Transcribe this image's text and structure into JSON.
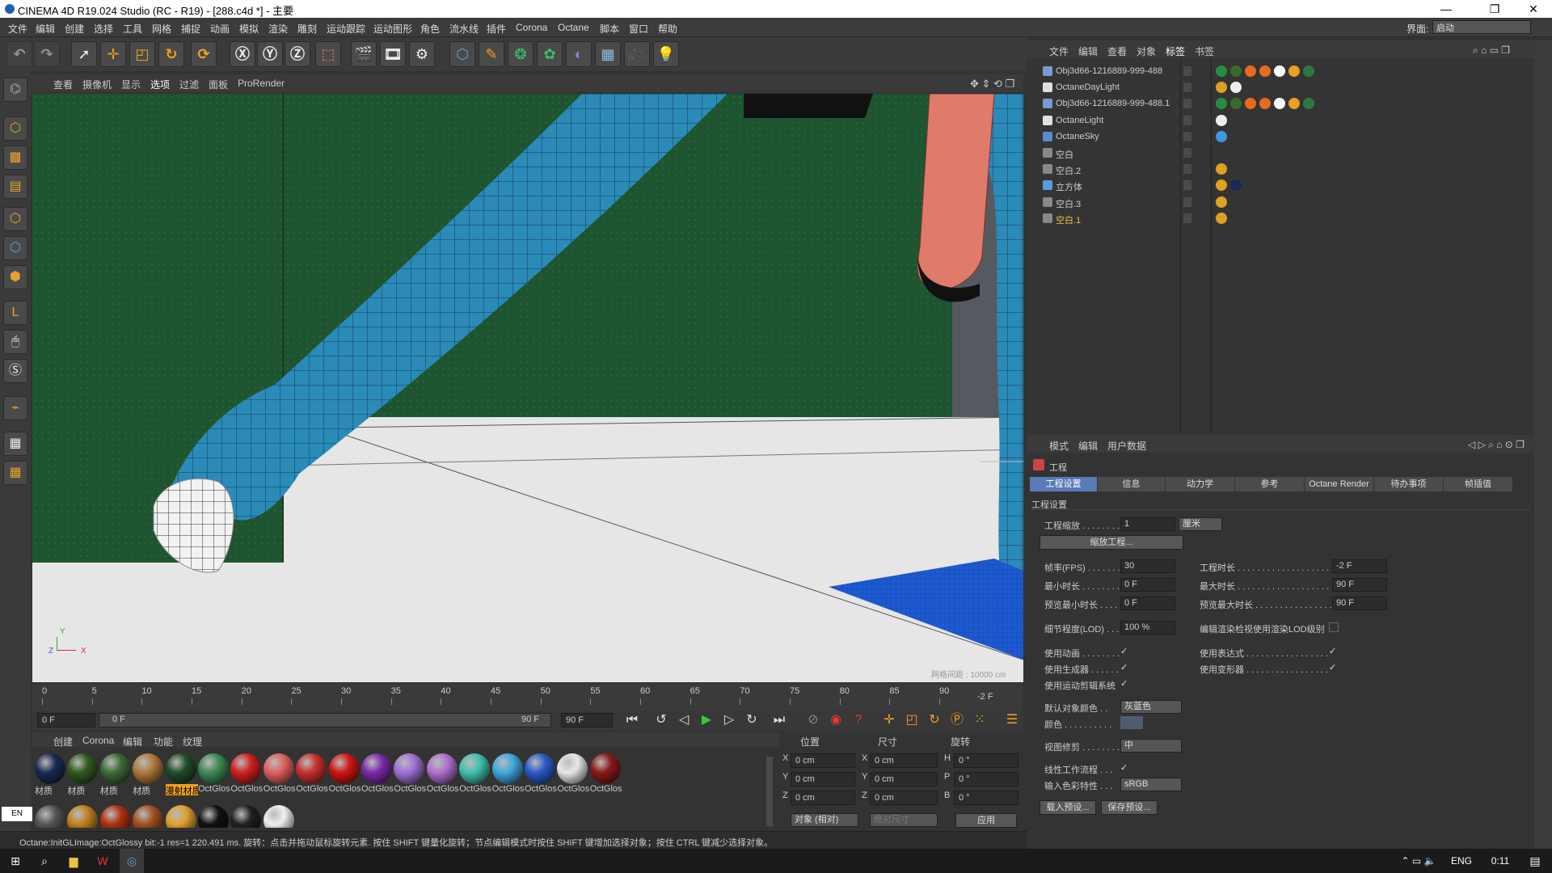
{
  "window": {
    "title": "CINEMA 4D R19.024 Studio (RC - R19) - [288.c4d *] - 主要",
    "min": "—",
    "max": "❐",
    "close": "✕"
  },
  "menu": [
    "文件",
    "编辑",
    "创建",
    "选择",
    "工具",
    "网格",
    "捕捉",
    "动画",
    "模拟",
    "渲染",
    "雕刻",
    "运动跟踪",
    "运动图形",
    "角色",
    "流水线",
    "插件",
    "Corona",
    "Octane",
    "脚本",
    "窗口",
    "帮助"
  ],
  "layout": {
    "label": "界面:",
    "value": "启动"
  },
  "viewport_menu": [
    "查看",
    "摄像机",
    "显示",
    "选项",
    "过滤",
    "面板",
    "ProRender"
  ],
  "viewport": {
    "grid_label": "网格间距 : 10000 cm",
    "axis_y": "Y",
    "axis_z": "Z",
    "axis_x": "X"
  },
  "timeline": {
    "ticks": [
      "0",
      "5",
      "10",
      "15",
      "20",
      "25",
      "30",
      "35",
      "40",
      "45",
      "50",
      "55",
      "60",
      "65",
      "70",
      "75",
      "80",
      "85",
      "90"
    ],
    "frame_display": "-2 F"
  },
  "transport": {
    "start": "0 F",
    "range_start": "0 F",
    "range_end": "90 F",
    "end": "90 F"
  },
  "materials": {
    "tabs": [
      "创建",
      "Corona",
      "编辑",
      "功能",
      "纹理"
    ],
    "row1": [
      {
        "label": "材质",
        "color": "#1a2a55"
      },
      {
        "label": "材质",
        "color": "#2f5a1e"
      },
      {
        "label": "材质",
        "color": "#3d6a38"
      },
      {
        "label": "材质",
        "color": "#b07a3a"
      },
      {
        "label": "漫射材质",
        "color": "#1f4d2a"
      },
      {
        "label": "OctGlos",
        "color": "#3d8a55"
      },
      {
        "label": "OctGlos",
        "color": "#d02020"
      },
      {
        "label": "OctGlos",
        "color": "#e06060"
      },
      {
        "label": "OctGlos",
        "color": "#c83030"
      },
      {
        "label": "OctGlos",
        "color": "#d01515"
      },
      {
        "label": "OctGlos",
        "color": "#7a2aa8"
      },
      {
        "label": "OctGlos",
        "color": "#a070d8"
      },
      {
        "label": "OctGlos",
        "color": "#b070d0"
      },
      {
        "label": "OctGlos",
        "color": "#40c0b0"
      },
      {
        "label": "OctGlos",
        "color": "#40a8e0"
      },
      {
        "label": "OctGlos",
        "color": "#2a5ac8"
      },
      {
        "label": "OctGlos",
        "color": "#e8e8e8"
      },
      {
        "label": "OctGlos",
        "color": "#8a1a1a"
      }
    ],
    "row2": [
      "#555",
      "#c08020",
      "#b03010",
      "#a05020",
      "#e0a030",
      "#111",
      "#202020",
      "#f0f0f0"
    ],
    "lang": "EN"
  },
  "coords": {
    "headers": [
      "位置",
      "尺寸",
      "旋转"
    ],
    "rows": [
      {
        "axis": "X",
        "pos": "0 cm",
        "size_axis": "X",
        "size": "0 cm",
        "rot_axis": "H",
        "rot": "0 °"
      },
      {
        "axis": "Y",
        "pos": "0 cm",
        "size_axis": "Y",
        "size": "0 cm",
        "rot_axis": "P",
        "rot": "0 °"
      },
      {
        "axis": "Z",
        "pos": "0 cm",
        "size_axis": "Z",
        "size": "0 cm",
        "rot_axis": "B",
        "rot": "0 °"
      }
    ],
    "mode": "对象 (相对)",
    "size_mode": "绝对尺寸",
    "apply": "应用"
  },
  "status": "Octane:InitGLImage:OctGlossy  bit:-1 res=1  220.491 ms.     旋转：点击并拖动鼠标旋转元素. 按住 SHIFT 键量化旋转；节点编辑模式时按住 SHIFT 键增加选择对象；按住 CTRL 键减少选择对象。",
  "objects": {
    "menu": [
      "文件",
      "编辑",
      "查看",
      "对象",
      "标签",
      "书签"
    ],
    "items": [
      {
        "name": "Obj3d66-1216889-999-488",
        "color": "#ccc",
        "icon": "#7a9ad0"
      },
      {
        "name": "OctaneDayLight",
        "color": "#ccc",
        "icon": "#e0e0e0"
      },
      {
        "name": "Obj3d66-1216889-999-488.1",
        "color": "#ccc",
        "icon": "#7a9ad0"
      },
      {
        "name": "OctaneLight",
        "color": "#ccc",
        "icon": "#e0e0e0"
      },
      {
        "name": "OctaneSky",
        "color": "#ccc",
        "icon": "#5a8ad0"
      },
      {
        "name": "空白",
        "color": "#ccc",
        "icon": "#888"
      },
      {
        "name": "空白.2",
        "color": "#ccc",
        "icon": "#888"
      },
      {
        "name": "立方体",
        "color": "#ccc",
        "icon": "#5a9ae0"
      },
      {
        "name": "空白.3",
        "color": "#ccc",
        "icon": "#888"
      },
      {
        "name": "空白.1",
        "color": "#f0c040",
        "icon": "#888"
      }
    ]
  },
  "attributes": {
    "menu": [
      "模式",
      "编辑",
      "用户数据"
    ],
    "section": "工程",
    "tabs": [
      "工程设置",
      "信息",
      "动力学",
      "参考",
      "Octane Render",
      "待办事项",
      "帧插值"
    ],
    "group": "工程设置",
    "scale_label": "工程缩放 . . . . . . . .",
    "scale_value": "1",
    "scale_unit": "厘米",
    "scale_button": "缩放工程...",
    "fps_label": "帧率(FPS) . . . . . . .",
    "fps": "30",
    "proj_time_label": "工程时长 . . . . . . . . . . . . . . . . . . .",
    "proj_time": "-2 F",
    "min_time_label": "最小时长 . . . . . . . .",
    "min_time": "0 F",
    "max_time_label": "最大时长 . . . . . . . . . . . . . . . . . . .",
    "max_time": "90 F",
    "prev_min_label": "预览最小时长 . . . .",
    "prev_min": "0 F",
    "prev_max_label": "预览最大时长 . . . . . . . . . . . . . . . .",
    "prev_max": "90 F",
    "lod_label": "细节程度(LOD) . . .",
    "lod": "100 %",
    "lod_render_label": "编辑渲染检视使用渲染LOD级别",
    "use_anim": "使用动画 . . . . . . . .",
    "use_expr": "使用表达式 . . . . . . . . . . . . . . . . .",
    "use_gen": "使用生成器 . . . . . .",
    "use_deform": "使用变形器 . . . . . . . . . . . . . . . . .",
    "use_motion": "使用运动剪辑系统",
    "default_color_label": "默认对象颜色 . .",
    "default_color": "灰蓝色",
    "color_label": "颜色 . . . . . . . . . .",
    "clip_label": "视图修剪 . . . . . . . .",
    "clip": "中",
    "linear_label": "线性工作流程 . . .",
    "input_label": "输入色彩特性 . . .",
    "input": "sRGB",
    "load_preset": "载入预设...",
    "save_preset": "保存预设..."
  },
  "taskbar": {
    "lang": "ENG",
    "time": "0:11"
  }
}
